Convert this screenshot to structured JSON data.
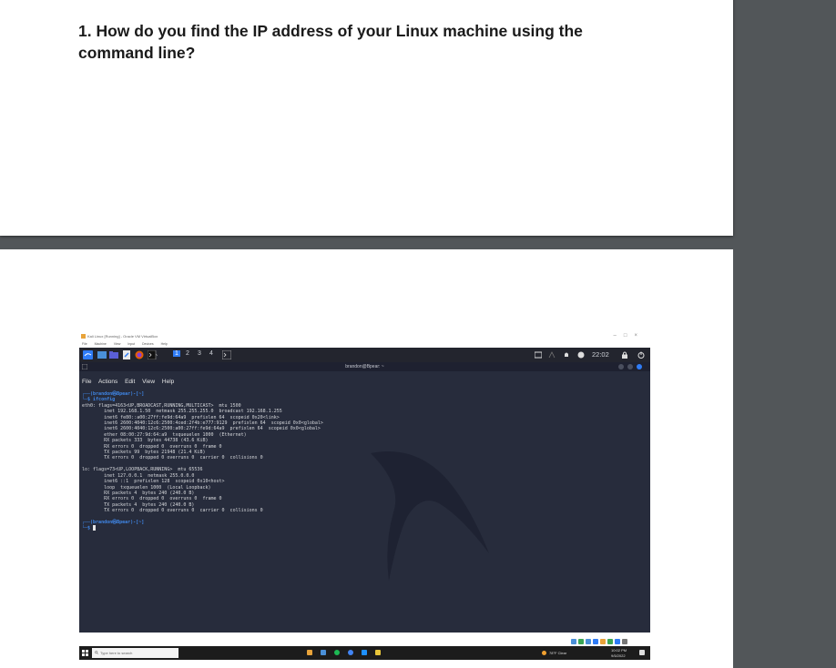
{
  "question": "1. How do you find the IP address of your Linux machine using the command line?",
  "vbox": {
    "window_title": "Kali Linux [Running] - Oracle VM VirtualBox",
    "menu": [
      "File",
      "Machine",
      "View",
      "Input",
      "Devices",
      "Help"
    ]
  },
  "kali_panel": {
    "workspaces": [
      "1",
      "2",
      "3",
      "4"
    ],
    "clock": "22:02"
  },
  "terminal": {
    "title": "brandon@Bpear: ~",
    "menu": [
      "File",
      "Actions",
      "Edit",
      "View",
      "Help"
    ],
    "prompt_line": "┌──(brandon㉿Bpear)-[~]",
    "command_line": "└─$ ifconfig",
    "output": "eth0: flags=4163<UP,BROADCAST,RUNNING,MULTICAST>  mtu 1500\n        inet 192.168.1.50  netmask 255.255.255.0  broadcast 192.168.1.255\n        inet6 fe80::a00:27ff:fe9d:64a9  prefixlen 64  scopeid 0x20<link>\n        inet6 2600:4040:12c6:2500:4ced:2f4b:e777:9129  prefixlen 64  scopeid 0x0<global>\n        inet6 2600:4040:12c6:2500:a00:27ff:fe9d:64a9  prefixlen 64  scopeid 0x0<global>\n        ether 08:00:27:9d:64:a9  txqueuelen 1000  (Ethernet)\n        RX packets 333  bytes 44738 (43.6 KiB)\n        RX errors 0  dropped 0  overruns 0  frame 0\n        TX packets 99  bytes 21948 (21.4 KiB)\n        TX errors 0  dropped 0 overruns 0  carrier 0  collisions 0\n\nlo: flags=73<UP,LOOPBACK,RUNNING>  mtu 65536\n        inet 127.0.0.1  netmask 255.0.0.0\n        inet6 ::1  prefixlen 128  scopeid 0x10<host>\n        loop  txqueuelen 1000  (Local Loopback)\n        RX packets 4  bytes 240 (240.0 B)\n        RX errors 0  dropped 0  overruns 0  frame 0\n        TX packets 4  bytes 240 (240.0 B)\n        TX errors 0  dropped 0 overruns 0  carrier 0  collisions 0\n",
    "prompt_line_2": "┌──(brandon㉿Bpear)-[~]",
    "command_line_2": "└─$ "
  },
  "taskbar": {
    "search_placeholder": "Type here to search",
    "weather": "78°F Clear",
    "time": "10:02 PM",
    "date": "9/5/2022"
  },
  "colors": {
    "pdf_background": "#525659",
    "terminal_bg": "#272c3c",
    "kali_panel_bg": "#23252e",
    "prompt_blue": "#3f86e6"
  }
}
